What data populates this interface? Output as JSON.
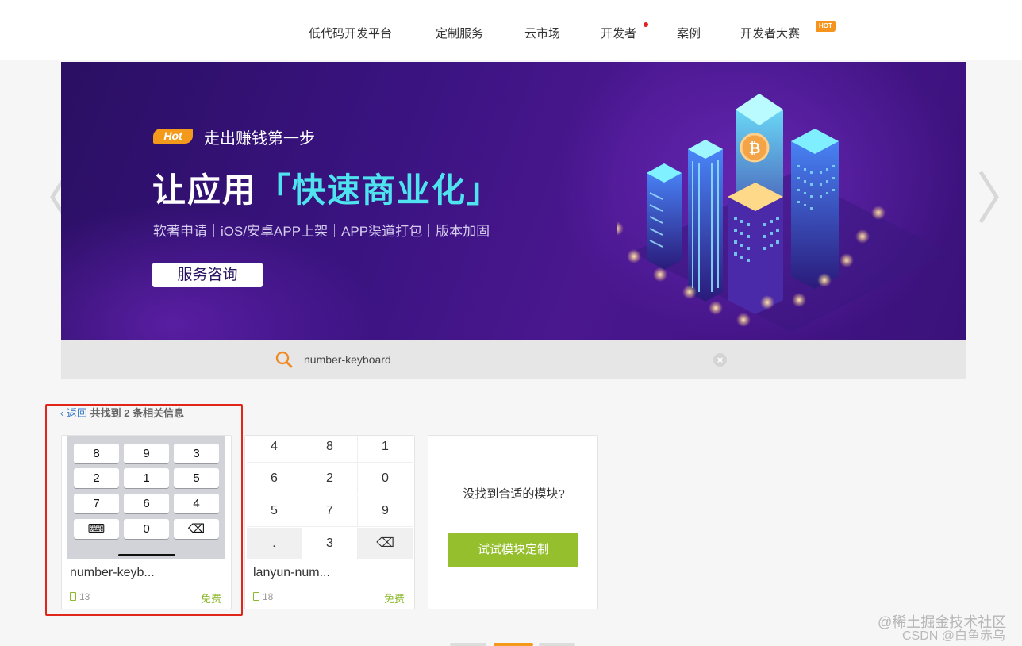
{
  "nav": {
    "items": [
      "低代码开发平台",
      "定制服务",
      "云市场",
      "开发者",
      "案例",
      "开发者大赛"
    ],
    "hot_badge": "HOT"
  },
  "banner": {
    "hot_label": "Hot",
    "subtitle": "走出赚钱第一步",
    "title_plain": "让应用",
    "title_accent": "「快速商业化」",
    "description": "软著申请｜iOS/安卓APP上架｜APP渠道打包｜版本加固",
    "button": "服务咨询",
    "coin_symbol": "₿",
    "prev_arrow": "〈",
    "next_arrow": "〉",
    "colors": {
      "accent": "#4fe3f0",
      "hot": "#f39a1c"
    }
  },
  "search": {
    "value": "number-keyboard",
    "clear_icon": "×"
  },
  "results": {
    "back": "‹ 返回",
    "prefix": "共找到",
    "count": "2",
    "suffix": "条相关信息"
  },
  "cards": [
    {
      "name": "number-keyb...",
      "count": "13",
      "price": "免费",
      "keys": [
        [
          "8",
          "9",
          "3"
        ],
        [
          "2",
          "1",
          "5"
        ],
        [
          "7",
          "6",
          "4"
        ],
        [
          "⌨",
          "0",
          "⌫"
        ]
      ]
    },
    {
      "name": "lanyun-num...",
      "count": "18",
      "price": "免费",
      "keys": [
        [
          "4",
          "8",
          "1"
        ],
        [
          "6",
          "2",
          "0"
        ],
        [
          "5",
          "7",
          "9"
        ],
        [
          ".",
          "3",
          "⌫"
        ]
      ]
    }
  ],
  "cta": {
    "text": "没找到合适的模块?",
    "button": "试试模块定制"
  },
  "watermark": {
    "line1": "@稀土掘金技术社区",
    "line2": "CSDN @白鱼赤乌"
  }
}
